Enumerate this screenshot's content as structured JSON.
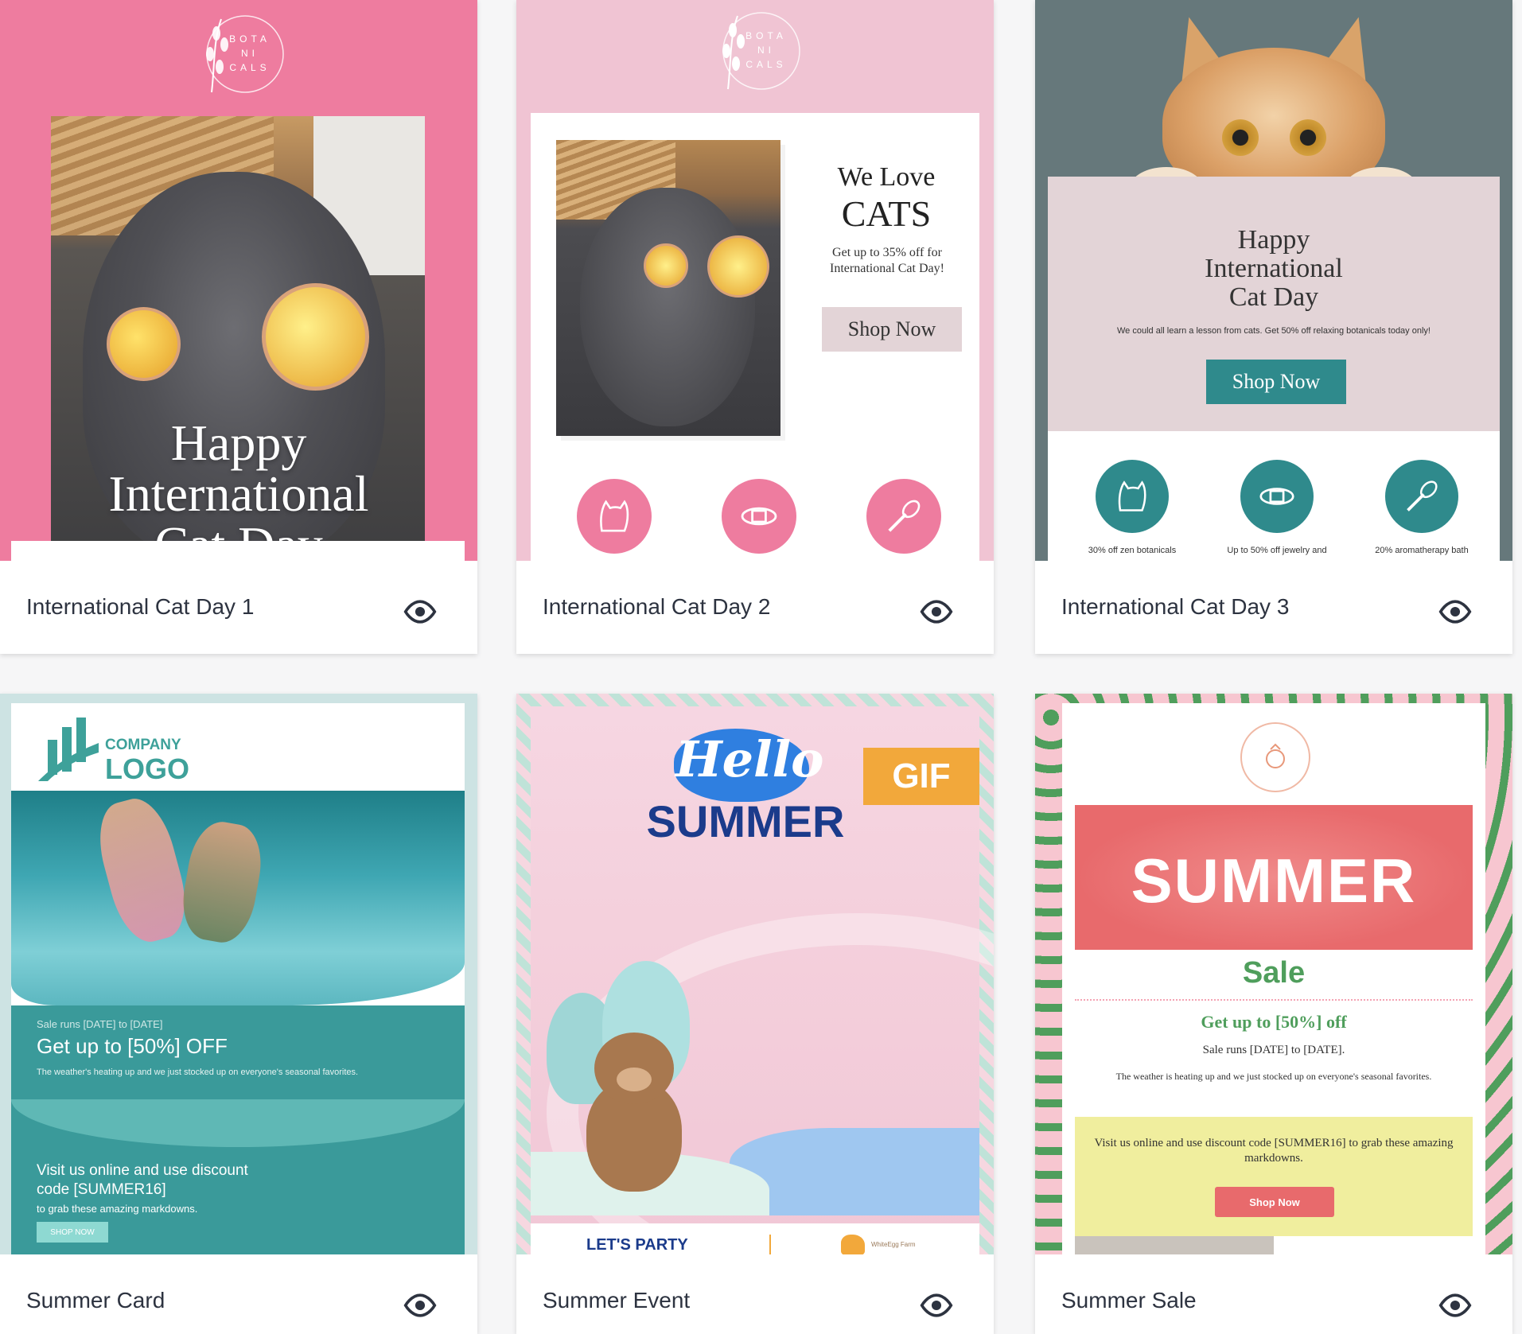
{
  "templates": [
    {
      "name": "International Cat Day 1",
      "logo": [
        "BOTA",
        "NI",
        "CALS"
      ],
      "headline": [
        "Happy",
        "International",
        "Cat Day"
      ]
    },
    {
      "name": "International Cat Day 2",
      "logo": [
        "BOTA",
        "NI",
        "CALS"
      ],
      "heading1": "We Love",
      "heading2": "CATS",
      "subtext": "Get up to 35% off for International Cat Day!",
      "cta": "Shop Now"
    },
    {
      "name": "International Cat Day 3",
      "headline": [
        "Happy",
        "International",
        "Cat Day"
      ],
      "subtext": "We could all learn a lesson from cats. Get 50% off relaxing botanicals today only!",
      "cta": "Shop Now",
      "features": [
        "30% off zen botanicals",
        "Up to 50% off jewelry and",
        "20% aromatherapy bath"
      ]
    },
    {
      "name": "Summer Card",
      "logo_top": "COMPANY",
      "logo_bottom": "LOGO",
      "dates": "Sale runs [DATE] to [DATE]",
      "offer": "Get up to [50%] OFF",
      "desc": "The weather's heating up and we just stocked up on everyone's seasonal favorites.",
      "visit": [
        "Visit us online and use discount",
        "code [SUMMER16]",
        "to grab these amazing markdowns."
      ],
      "cta": "SHOP NOW"
    },
    {
      "name": "Summer Event",
      "hello": "Hello",
      "summer": "SUMMER",
      "badge": "GIF",
      "party": "LET'S PARTY",
      "brand": "WhiteEgg Farm"
    },
    {
      "name": "Summer Sale",
      "summer": "SUMMER",
      "sale": "Sale",
      "offer": "Get up to [50%] off",
      "dates": "Sale runs [DATE] to [DATE].",
      "desc": "The weather is heating up and we just stocked up on everyone's seasonal favorites.",
      "visit": "Visit us online and use discount code [SUMMER16] to grab these amazing markdowns.",
      "cta": "Shop Now"
    }
  ],
  "colors": {
    "pink": "#ee7c9f",
    "light_pink": "#f0c4d3",
    "slate": "#66787b",
    "teal": "#2f8a8c",
    "mauve": "#e3d4d7",
    "orange": "#f2a83b",
    "navy": "#1b3b8b",
    "watermelon": "#e86a6c",
    "green": "#4f9e5c",
    "lemon": "#f0ee9e"
  }
}
